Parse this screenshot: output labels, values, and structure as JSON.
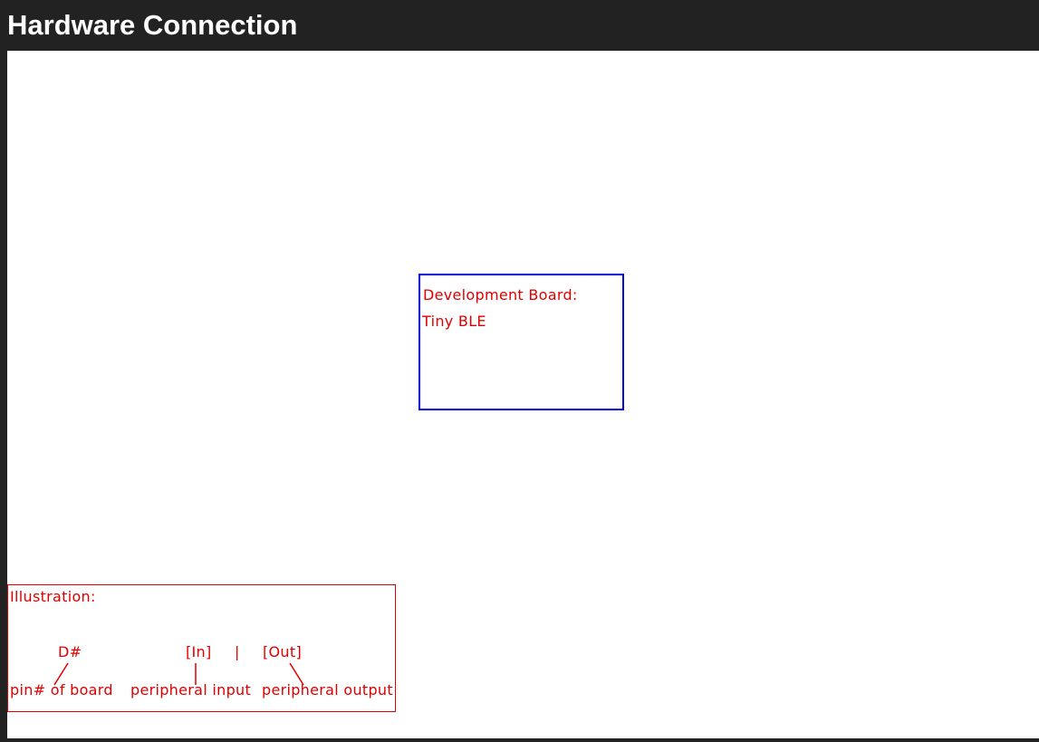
{
  "header": {
    "title": "Hardware Connection"
  },
  "board": {
    "label": "Development Board:",
    "name": "Tiny BLE"
  },
  "illustration": {
    "title": "Illustration:",
    "pin_symbol": "D#",
    "in_symbol": "[In]",
    "separator": "|",
    "out_symbol": "[Out]",
    "pin_desc": "pin# of board",
    "in_desc": "peripheral input",
    "out_desc": "peripheral output"
  },
  "colors": {
    "header_bg": "#222222",
    "canvas_bg": "#ffffff",
    "board_border": "#0000e0",
    "annotation": "#e00000"
  }
}
